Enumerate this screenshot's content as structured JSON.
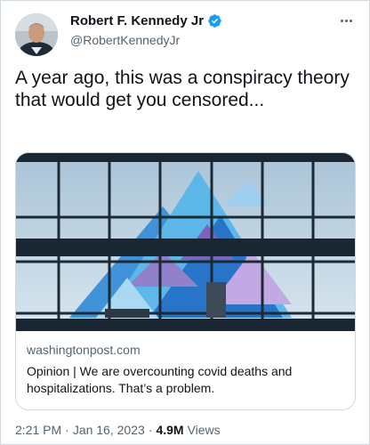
{
  "author": {
    "display_name": "Robert F. Kennedy Jr",
    "handle": "@RobertKennedyJr",
    "verified_color": "#1d9bf0"
  },
  "tweet": {
    "text": "A year ago, this was a conspiracy theory that would get you censored..."
  },
  "link_card": {
    "domain": "washingtonpost.com",
    "title": "Opinion | We are overcounting covid deaths and hospitalizations. That’s a problem."
  },
  "meta": {
    "time": "2:21 PM",
    "separator": "·",
    "date": "Jan 16, 2023",
    "views_count": "4.9M",
    "views_label": "Views"
  },
  "icons": {
    "more": "more-horizontal-icon",
    "verified": "verified-badge-icon"
  }
}
